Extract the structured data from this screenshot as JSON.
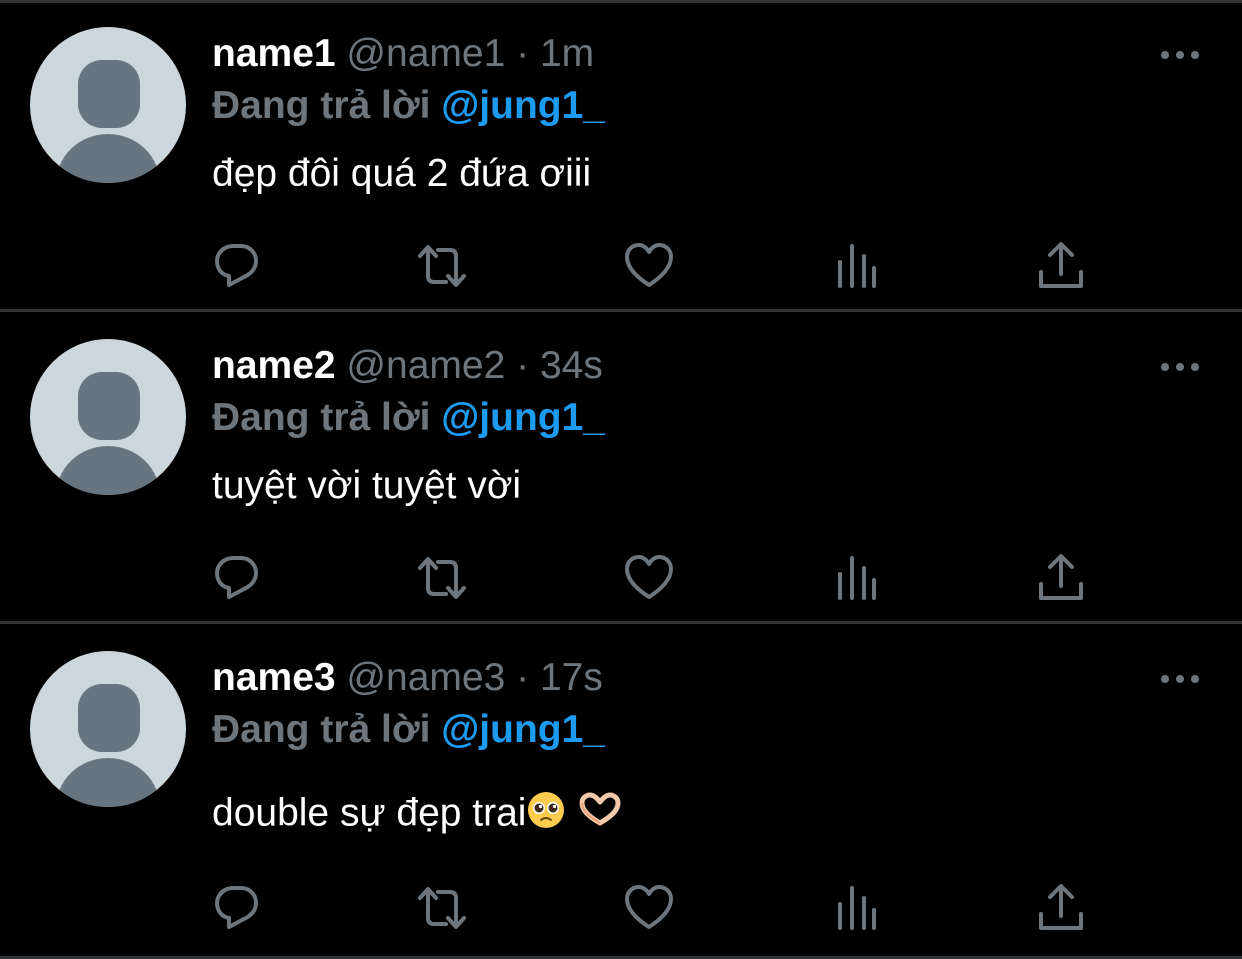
{
  "tweets": [
    {
      "display_name": "name1",
      "handle": "@name1",
      "separator": "·",
      "time": "1m",
      "reply_prefix": "Đang trả lời",
      "reply_mention": "@jung1_",
      "text": "đẹp đôi quá 2 đứa ơiii"
    },
    {
      "display_name": "name2",
      "handle": "@name2",
      "separator": "·",
      "time": "34s",
      "reply_prefix": "Đang trả lời",
      "reply_mention": "@jung1_",
      "text": "tuyệt vời tuyệt vời"
    },
    {
      "display_name": "name3",
      "handle": "@name3",
      "separator": "·",
      "time": "17s",
      "reply_prefix": "Đang trả lời",
      "reply_mention": "@jung1_",
      "text": "double sự đẹp trai",
      "emojis": [
        "pleading-face-emoji",
        "heart-hands-emoji"
      ]
    }
  ],
  "icons": {
    "more": "more-options-icon",
    "reply": "reply-icon",
    "retweet": "retweet-icon",
    "like": "like-icon",
    "analytics": "analytics-icon",
    "share": "share-icon"
  },
  "colors": {
    "background": "#000000",
    "divider": "#2f3336",
    "secondary_text": "#6e767d",
    "mention": "#1d9bf0",
    "avatar_bg": "#ccd6dd",
    "avatar_fg": "#66757f"
  }
}
